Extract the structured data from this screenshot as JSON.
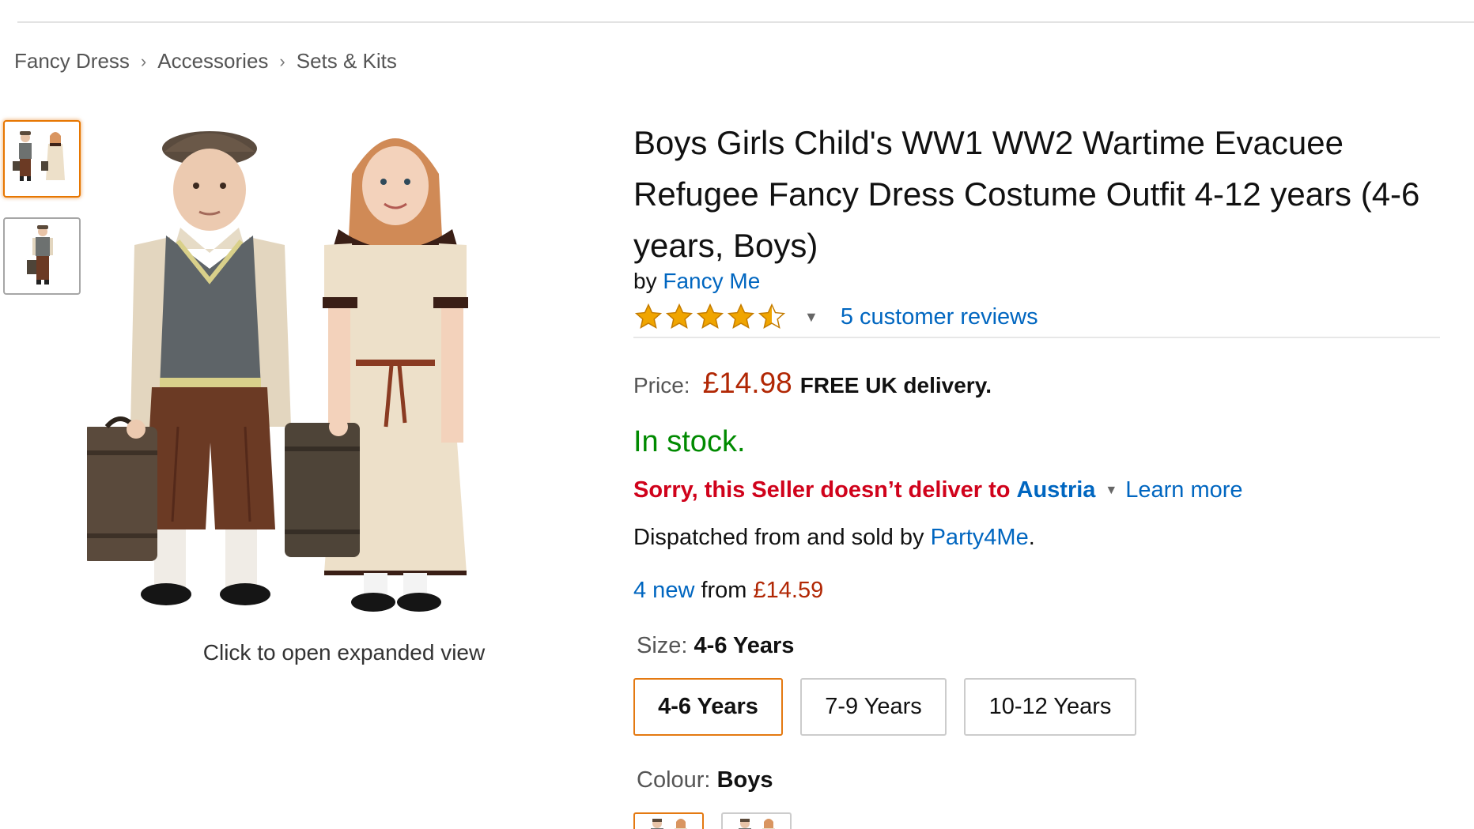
{
  "breadcrumb": [
    "Fancy Dress",
    "Accessories",
    "Sets & Kits"
  ],
  "breadcrumb_separator": "›",
  "gallery": {
    "thumbnails": [
      "boys-and-girls-photo",
      "boy-only-photo"
    ],
    "selected_index": 0,
    "caption": "Click to open expanded view"
  },
  "product": {
    "title": "Boys Girls Child's WW1 WW2 Wartime Evacuee Refugee Fancy Dress Costume Outfit 4-12 years (4-6 years, Boys)",
    "by_prefix": "by",
    "brand": "Fancy Me",
    "rating": 4.5,
    "rating_max": 5,
    "reviews_link": "5 customer reviews"
  },
  "pricing": {
    "label": "Price:",
    "price": "£14.98",
    "delivery": "FREE UK delivery."
  },
  "availability": {
    "stock": "In stock.",
    "sorry": "Sorry, this Seller doesn’t deliver to",
    "country": "Austria",
    "learn_more": "Learn more",
    "dispatch_prefix": "Dispatched from and sold by",
    "seller": "Party4Me",
    "dispatch_suffix": "."
  },
  "offers": {
    "link": "4 new",
    "from": "from",
    "price": "£14.59"
  },
  "size": {
    "label": "Size:",
    "selected": "4-6 Years",
    "options": [
      "4-6 Years",
      "7-9 Years",
      "10-12 Years"
    ]
  },
  "colour": {
    "label": "Colour:",
    "selected": "Boys"
  },
  "colors": {
    "link": "#0066c0",
    "price": "#b12704",
    "stock": "#008a00",
    "error": "#d0021b",
    "selected_border": "#e47911",
    "star": "#f0a500"
  }
}
